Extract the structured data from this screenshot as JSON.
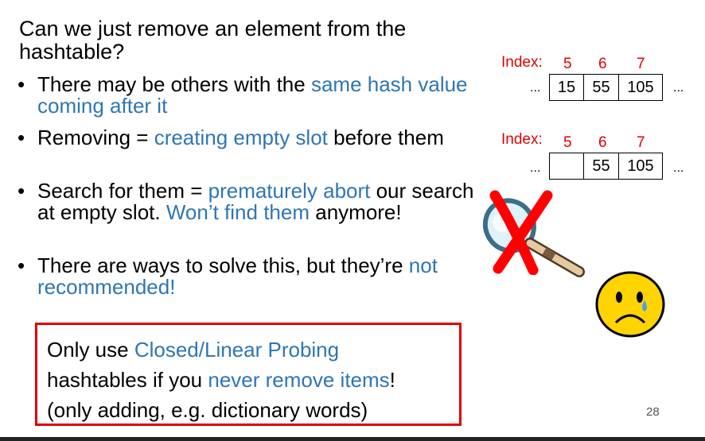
{
  "title": "Can we just remove an element from the hashtable?",
  "bullets": [
    {
      "parts": [
        {
          "text": "There may be others with the ",
          "color": "black"
        },
        {
          "text": "same hash value coming after it",
          "color": "blue"
        }
      ]
    },
    {
      "parts": [
        {
          "text": "Removing = ",
          "color": "black"
        },
        {
          "text": "creating empty slot",
          "color": "blue"
        },
        {
          "text": " before them",
          "color": "black"
        }
      ]
    },
    {
      "parts": [
        {
          "text": "Search for them = ",
          "color": "black"
        },
        {
          "text": "prematurely abort",
          "color": "blue"
        },
        {
          "text": " our search at empty slot. ",
          "color": "black"
        },
        {
          "text": "Won’t find them",
          "color": "blue"
        },
        {
          "text": " anymore!",
          "color": "black"
        }
      ]
    },
    {
      "parts": [
        {
          "text": "There are ways to solve this, but they’re ",
          "color": "black"
        },
        {
          "text": "not recommended!",
          "color": "blue"
        }
      ]
    }
  ],
  "bullet_char": "•",
  "callout": {
    "line1_a": "Only use ",
    "line1_b": "Closed/Linear Probing",
    "line2_a": "hashtables if you ",
    "line2_b": "never remove items",
    "line2_c": "!",
    "line3": "(only adding, e.g. dictionary words)"
  },
  "diagram_top": {
    "index_label": "Index:",
    "indices": [
      "5",
      "6",
      "7"
    ],
    "cells": [
      "15",
      "55",
      "105"
    ],
    "ellipsis": "..."
  },
  "diagram_bottom": {
    "index_label": "Index:",
    "indices": [
      "5",
      "6",
      "7"
    ],
    "cells": [
      "",
      "55",
      "105"
    ],
    "ellipsis": "..."
  },
  "icons": {
    "magnifier": "magnifying-glass-icon",
    "cross": "red-x-icon",
    "sad": "sad-face-icon"
  },
  "colors": {
    "blue": "#2E75B6",
    "red": "#E00000"
  },
  "page_number": "28"
}
